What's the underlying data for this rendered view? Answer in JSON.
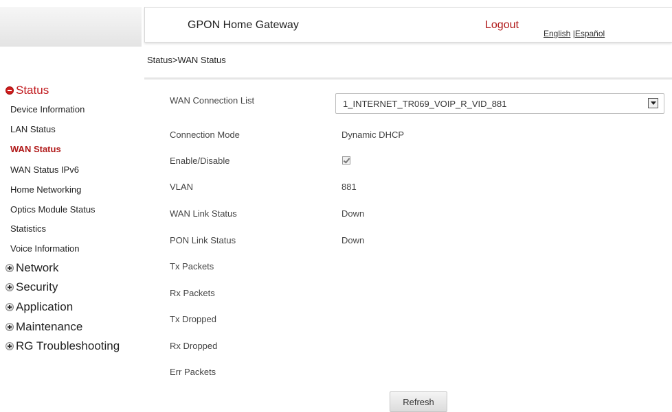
{
  "header": {
    "title": "GPON Home Gateway",
    "logout": "Logout",
    "lang_english": "English",
    "lang_separator": " |",
    "lang_spanish": "Español"
  },
  "breadcrumb": "Status>WAN Status",
  "sidebar": {
    "status_group": "Status",
    "status_items": [
      "Device Information",
      "LAN Status",
      "WAN Status",
      "WAN Status IPv6",
      "Home Networking",
      "Optics Module Status",
      "Statistics",
      "Voice Information"
    ],
    "groups": [
      "Network",
      "Security",
      "Application",
      "Maintenance",
      "RG Troubleshooting"
    ]
  },
  "form": {
    "wan_list_label": "WAN Connection List",
    "wan_list_value": "1_INTERNET_TR069_VOIP_R_VID_881",
    "connection_mode_label": "Connection Mode",
    "connection_mode_value": "Dynamic DHCP",
    "enable_label": "Enable/Disable",
    "enabled": true,
    "vlan_label": "VLAN",
    "vlan_value": "881",
    "wan_link_label": "WAN Link Status",
    "wan_link_value": "Down",
    "pon_link_label": "PON Link Status",
    "pon_link_value": "Down",
    "tx_packets_label": "Tx Packets",
    "rx_packets_label": "Rx Packets",
    "tx_dropped_label": "Tx Dropped",
    "rx_dropped_label": "Rx Dropped",
    "err_packets_label": "Err Packets"
  },
  "refresh_label": "Refresh",
  "colors": {
    "accent": "#c0171b"
  }
}
